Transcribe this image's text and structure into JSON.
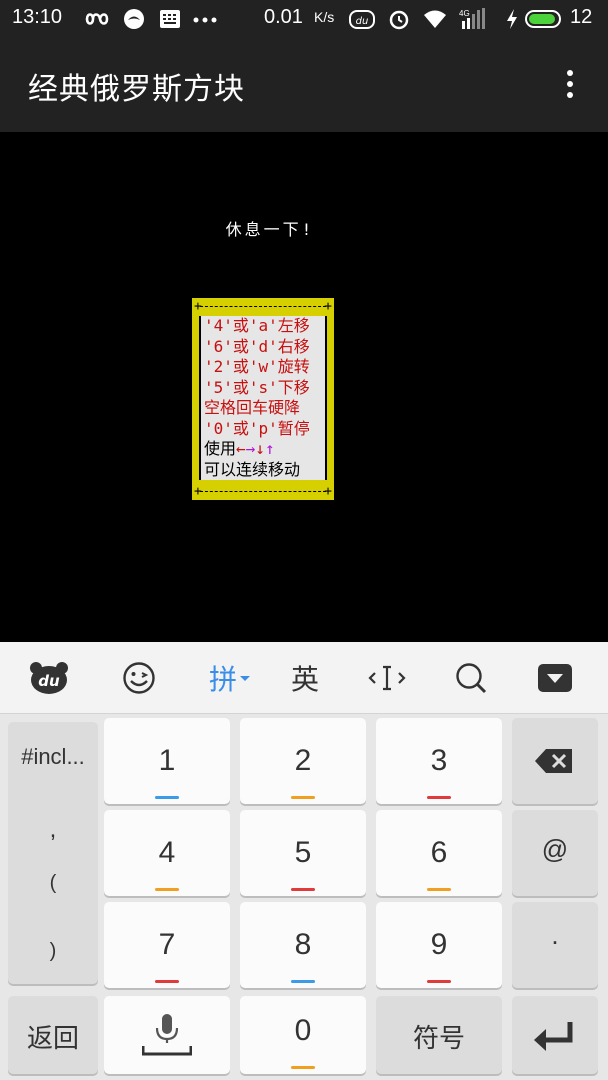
{
  "status_bar": {
    "time": "13:10",
    "network_speed": "0.01",
    "network_unit": "K/s",
    "battery_level": "12",
    "icons": [
      "infinity-icon",
      "app-notification-icon",
      "keyboard-icon",
      "more-dots-icon",
      "du-icon",
      "alarm-icon",
      "wifi-icon",
      "signal-4g-icon",
      "charging-icon",
      "battery-icon"
    ]
  },
  "app_bar": {
    "title": "经典俄罗斯方块",
    "menu_icon": "overflow-menu-icon"
  },
  "game": {
    "pause_message": "休息一下!",
    "help_lines": [
      "'4'或'a'左移",
      "'6'或'd'右移",
      "'2'或'w'旋转",
      "'5'或's'下移",
      "空格回车硬降",
      "'0'或'p'暂停"
    ],
    "arrow_line_prefix": "使用",
    "arrows": [
      "←",
      "→",
      "↓",
      "↑"
    ],
    "continuous_move": "可以连续移动",
    "colors": {
      "panel": "#d6d000",
      "text_red": "#c81010",
      "arrow_purple": "#b018d8"
    }
  },
  "keyboard": {
    "toolbar": {
      "logo": "du",
      "pinyin": "拼",
      "english": "英"
    },
    "side_panel": {
      "top": "#incl...",
      "symbols": [
        ",",
        "(",
        ")"
      ],
      "back": "返回"
    },
    "digits": [
      "1",
      "2",
      "3",
      "4",
      "5",
      "6",
      "7",
      "8",
      "9",
      "0"
    ],
    "right_keys": [
      "@",
      "."
    ],
    "symbols_key": "符号",
    "accent": "#3b8ee8"
  }
}
